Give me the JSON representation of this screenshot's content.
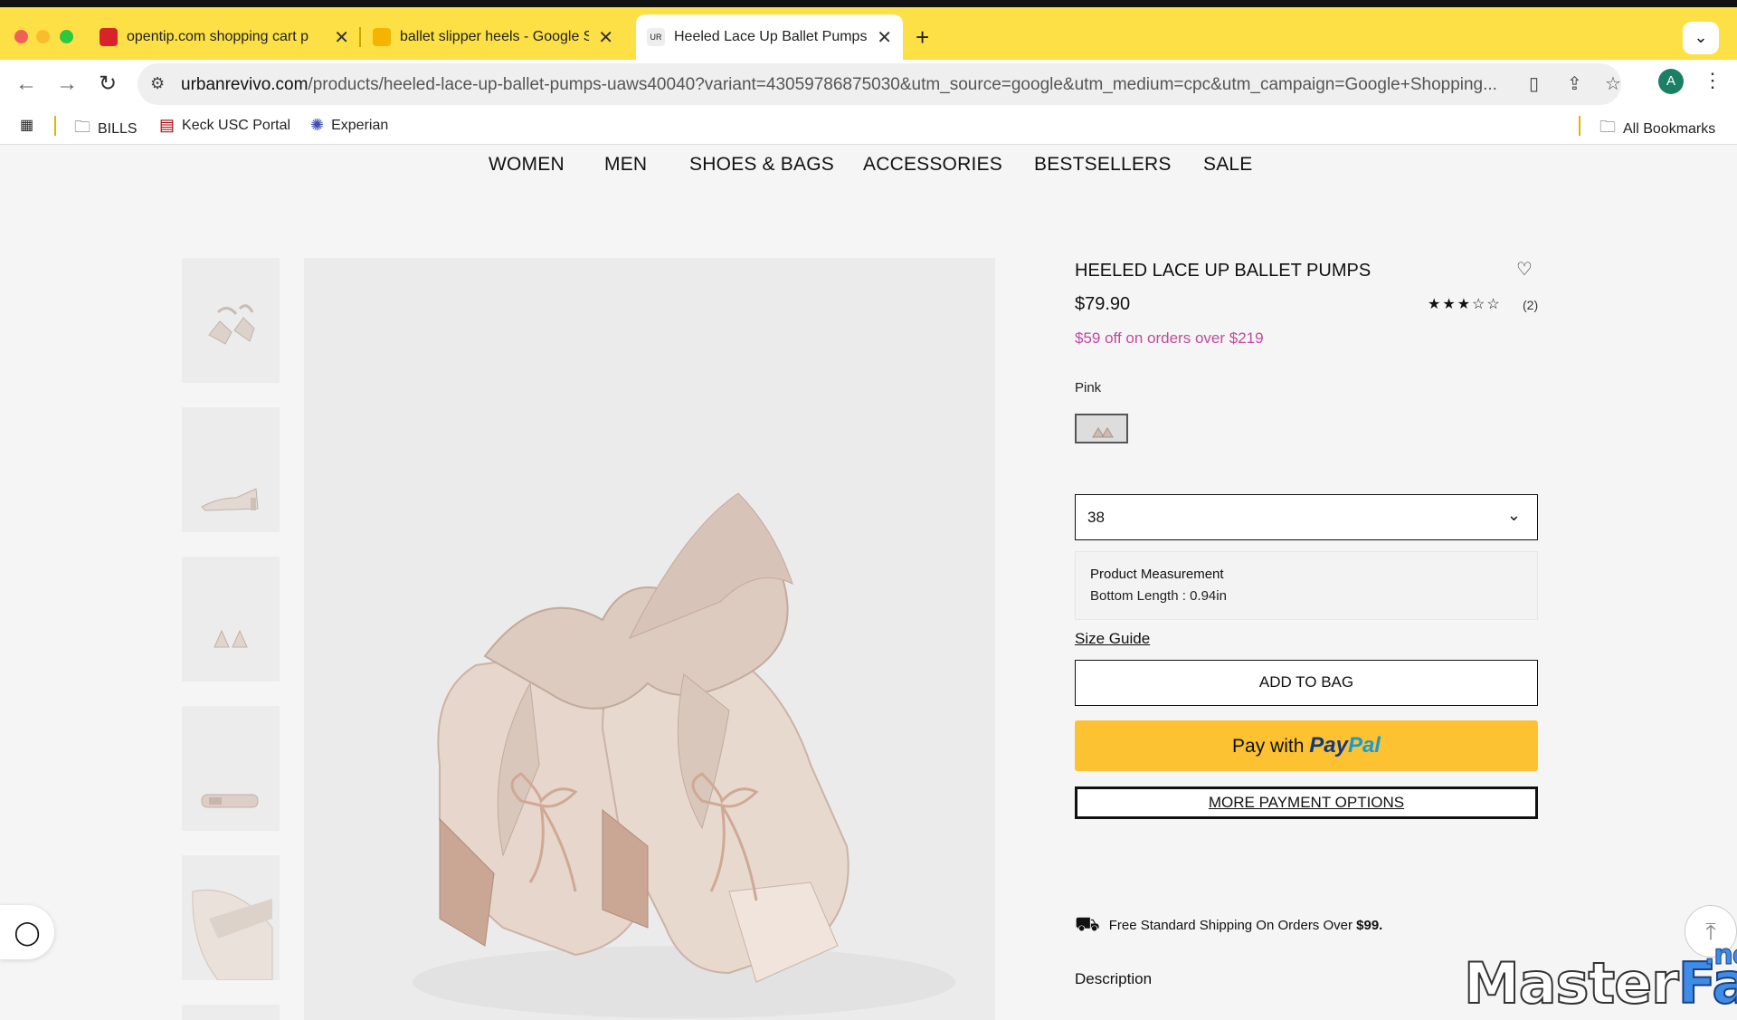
{
  "browser": {
    "tabs": [
      {
        "title": "opentip.com shopping cart p",
        "close": "✕"
      },
      {
        "title": "ballet slipper heels - Google S",
        "close": "✕"
      },
      {
        "title": "Heeled Lace Up Ballet Pumps",
        "close": "✕"
      }
    ],
    "new_tab": "+",
    "tab_menu": "⌄",
    "url_host": "urbanrevivo.com",
    "url_path": "/products/heeled-lace-up-ballet-pumps-uaws40040?variant=43059786875030&utm_source=google&utm_medium=cpc&utm_campaign=Google+Shopping...",
    "avatar_letter": "A",
    "bookmarks": [
      {
        "label": "BILLS",
        "icon": "folder-icon"
      },
      {
        "label": "Keck USC Portal",
        "icon": "usc-icon"
      },
      {
        "label": "Experian",
        "icon": "experian-icon"
      }
    ],
    "all_bookmarks": "All Bookmarks",
    "accent_color": "#fde046"
  },
  "site_nav": [
    "WOMEN",
    "MEN",
    "SHOES & BAGS",
    "ACCESSORIES",
    "BESTSELLERS",
    "SALE"
  ],
  "product": {
    "title": "HEELED LACE UP BALLET PUMPS",
    "price": "$79.90",
    "rating": 3,
    "rating_max": 5,
    "review_count": "(2)",
    "promo": "$59 off on orders over $219",
    "color_label": "Pink",
    "size_value": "38",
    "measurement_title": "Product Measurement",
    "measurement_label": "Bottom Length :",
    "measurement_value": "0.94in",
    "size_guide": "Size Guide",
    "add_to_bag": "ADD TO BAG",
    "pay_with": "Pay with",
    "paypal_1": "Pay",
    "paypal_2": "Pal",
    "more_payment": "MORE PAYMENT OPTIONS",
    "shipping_text": "Free Standard Shipping On Orders Over",
    "shipping_amount": "$99.",
    "description_label": "Description",
    "promo_color": "#c04aa0",
    "paypal_color": "#fcc232"
  },
  "watermark": {
    "part1": "Master",
    "part2": "Fap",
    "part3": ".net"
  }
}
